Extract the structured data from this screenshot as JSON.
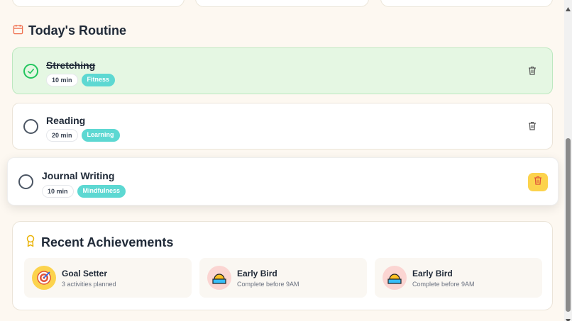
{
  "routine": {
    "title": "Today's Routine",
    "tasks": [
      {
        "name": "Stretching",
        "duration": "10 min",
        "category": "Fitness",
        "done": true
      },
      {
        "name": "Reading",
        "duration": "20 min",
        "category": "Learning",
        "done": false
      },
      {
        "name": "Journal Writing",
        "duration": "10 min",
        "category": "Mindfulness",
        "done": false
      }
    ]
  },
  "achievements": {
    "title": "Recent Achievements",
    "items": [
      {
        "name": "Goal Setter",
        "description": "3 activities planned",
        "icon": "target-icon"
      },
      {
        "name": "Early Bird",
        "description": "Complete before 9AM",
        "icon": "sunrise-icon"
      },
      {
        "name": "Early Bird",
        "description": "Complete before 9AM",
        "icon": "sunrise-icon"
      }
    ]
  },
  "colors": {
    "background": "#fdf8f1",
    "done_bg": "#e5f7e3",
    "check_green": "#22c55e",
    "tag_teal": "#5dd8d2",
    "delete_active": "#fcd34d",
    "calendar_orange": "#ef6f4f"
  }
}
